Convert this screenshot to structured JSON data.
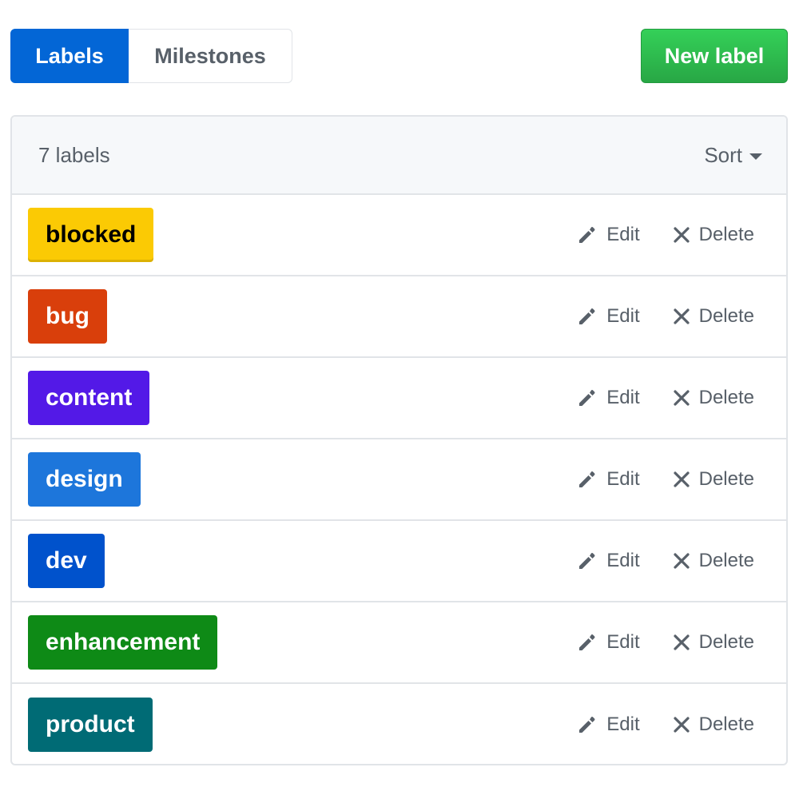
{
  "subnav": {
    "labels_tab": "Labels",
    "milestones_tab": "Milestones"
  },
  "new_label_button": "New label",
  "header": {
    "count": "7 labels",
    "sort": "Sort"
  },
  "actions": {
    "edit": "Edit",
    "delete": "Delete"
  },
  "labels": [
    {
      "name": "blocked",
      "bg": "#fbca04",
      "fg": "#000000"
    },
    {
      "name": "bug",
      "bg": "#d93f0b",
      "fg": "#ffffff"
    },
    {
      "name": "content",
      "bg": "#5319e7",
      "fg": "#ffffff"
    },
    {
      "name": "design",
      "bg": "#1d76db",
      "fg": "#ffffff"
    },
    {
      "name": "dev",
      "bg": "#0052cc",
      "fg": "#ffffff"
    },
    {
      "name": "enhancement",
      "bg": "#0e8a16",
      "fg": "#ffffff"
    },
    {
      "name": "product",
      "bg": "#006b75",
      "fg": "#ffffff"
    }
  ]
}
